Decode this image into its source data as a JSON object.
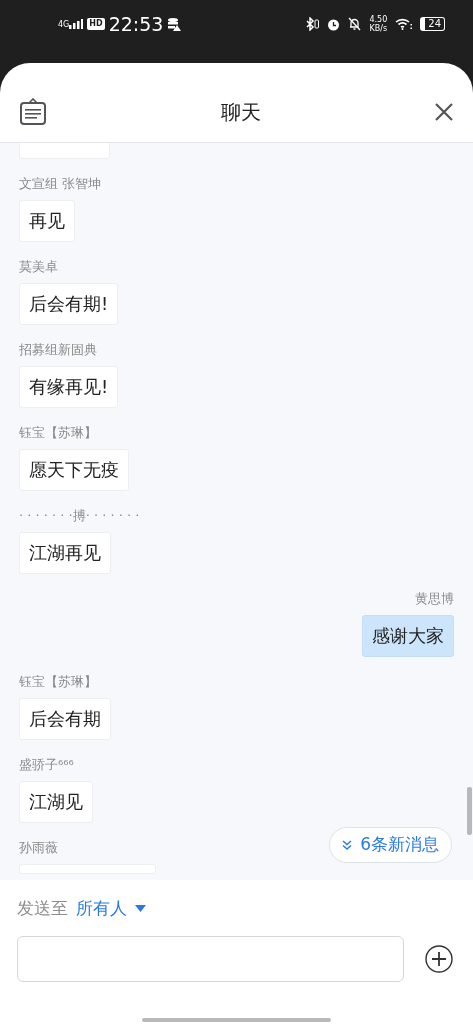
{
  "status_bar": {
    "network": "4G",
    "hd": "HD",
    "time": "22:53",
    "speed": "4.50",
    "speed_unit": "KB/s",
    "battery": "24"
  },
  "sheet": {
    "title": "聊天"
  },
  "messages": [
    {
      "kind": "clipped_top"
    },
    {
      "kind": "incoming",
      "sender": "文宣组 张智坤",
      "text": "再见"
    },
    {
      "kind": "incoming",
      "sender": "莫美卓",
      "text": "后会有期!"
    },
    {
      "kind": "incoming",
      "sender": "招募组新固典",
      "text": "有缘再见!"
    },
    {
      "kind": "incoming",
      "sender": "钰宝【苏琳】",
      "text": "愿天下无疫"
    },
    {
      "kind": "incoming",
      "sender": "· · · · · · ·搏· · · · · · ·",
      "text": "江湖再见"
    },
    {
      "kind": "outgoing",
      "sender": "黄思博",
      "text": "感谢大家"
    },
    {
      "kind": "incoming",
      "sender": "钰宝【苏琳】",
      "text": "后会有期"
    },
    {
      "kind": "incoming",
      "sender": "盛骄子⁶⁶⁶",
      "text": "江湖见"
    },
    {
      "kind": "clipped_bottom",
      "sender": "孙雨薇"
    }
  ],
  "new_messages": "6条新消息",
  "composer": {
    "send_to_label": "发送至",
    "recipient": "所有人"
  }
}
